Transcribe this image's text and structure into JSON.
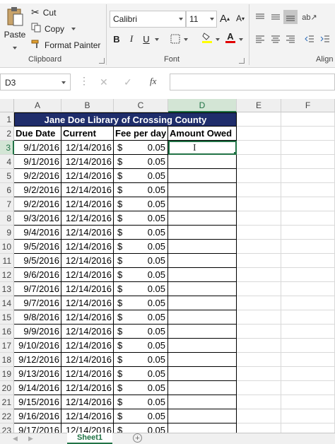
{
  "clipboard": {
    "cut": "Cut",
    "copy": "Copy",
    "paste": "Paste",
    "format_painter": "Format Painter",
    "group_label": "Clipboard"
  },
  "font": {
    "name": "Calibri",
    "size": "11",
    "group_label": "Font"
  },
  "alignment": {
    "group_label": "Align"
  },
  "formula_bar": {
    "name_box": "D3",
    "fx": "fx",
    "value": ""
  },
  "columns": [
    "A",
    "B",
    "C",
    "D",
    "E",
    "F"
  ],
  "sheet": {
    "title": "Jane Doe Library of Crossing County",
    "headers": {
      "a": "Due Date",
      "b": "Current",
      "c": "Fee per day",
      "d": "Amount Owed"
    },
    "currency": "$",
    "rows": [
      {
        "row": "3",
        "due": "9/1/2016",
        "current": "12/14/2016",
        "fee": "0.05"
      },
      {
        "row": "4",
        "due": "9/1/2016",
        "current": "12/14/2016",
        "fee": "0.05"
      },
      {
        "row": "5",
        "due": "9/2/2016",
        "current": "12/14/2016",
        "fee": "0.05"
      },
      {
        "row": "6",
        "due": "9/2/2016",
        "current": "12/14/2016",
        "fee": "0.05"
      },
      {
        "row": "7",
        "due": "9/2/2016",
        "current": "12/14/2016",
        "fee": "0.05"
      },
      {
        "row": "8",
        "due": "9/3/2016",
        "current": "12/14/2016",
        "fee": "0.05"
      },
      {
        "row": "9",
        "due": "9/4/2016",
        "current": "12/14/2016",
        "fee": "0.05"
      },
      {
        "row": "10",
        "due": "9/5/2016",
        "current": "12/14/2016",
        "fee": "0.05"
      },
      {
        "row": "11",
        "due": "9/5/2016",
        "current": "12/14/2016",
        "fee": "0.05"
      },
      {
        "row": "12",
        "due": "9/6/2016",
        "current": "12/14/2016",
        "fee": "0.05"
      },
      {
        "row": "13",
        "due": "9/7/2016",
        "current": "12/14/2016",
        "fee": "0.05"
      },
      {
        "row": "14",
        "due": "9/7/2016",
        "current": "12/14/2016",
        "fee": "0.05"
      },
      {
        "row": "15",
        "due": "9/8/2016",
        "current": "12/14/2016",
        "fee": "0.05"
      },
      {
        "row": "16",
        "due": "9/9/2016",
        "current": "12/14/2016",
        "fee": "0.05"
      },
      {
        "row": "17",
        "due": "9/10/2016",
        "current": "12/14/2016",
        "fee": "0.05"
      },
      {
        "row": "18",
        "due": "9/12/2016",
        "current": "12/14/2016",
        "fee": "0.05"
      },
      {
        "row": "19",
        "due": "9/13/2016",
        "current": "12/14/2016",
        "fee": "0.05"
      },
      {
        "row": "20",
        "due": "9/14/2016",
        "current": "12/14/2016",
        "fee": "0.05"
      },
      {
        "row": "21",
        "due": "9/15/2016",
        "current": "12/14/2016",
        "fee": "0.05"
      },
      {
        "row": "22",
        "due": "9/16/2016",
        "current": "12/14/2016",
        "fee": "0.05"
      },
      {
        "row": "23",
        "due": "9/17/2016",
        "current": "12/14/2016",
        "fee": "0.05"
      }
    ]
  },
  "sheet_tab": "Sheet1",
  "colors": {
    "title_fill": "#1f2d6b",
    "accent": "#217346",
    "selection_header": "#d3e5d5"
  }
}
